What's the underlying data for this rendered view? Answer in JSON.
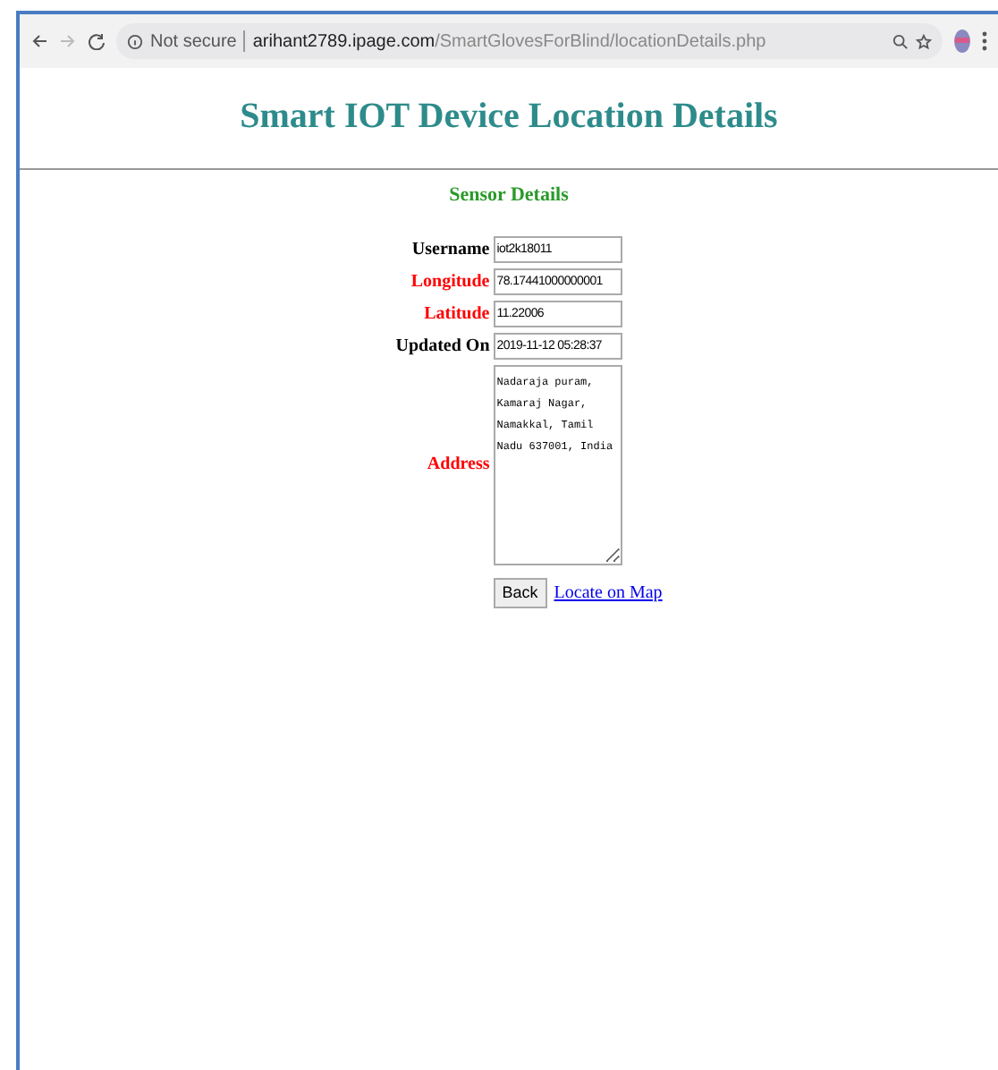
{
  "browser": {
    "security": "Not secure",
    "url_host": "arihant2789.ipage.com",
    "url_path": "/SmartGlovesForBlind/locationDetails.php"
  },
  "page": {
    "title": "Smart IOT Device Location Details",
    "section": "Sensor Details",
    "fields": [
      {
        "label": "Username",
        "color": "#000000",
        "kind": "text",
        "value": "iot2k18011"
      },
      {
        "label": "Longitude",
        "color": "#ff0000",
        "kind": "text",
        "value": "78.17441000000001"
      },
      {
        "label": "Latitude",
        "color": "#ff0000",
        "kind": "text",
        "value": "11.22006"
      },
      {
        "label": "Updated On",
        "color": "#000000",
        "kind": "text",
        "value": "2019-11-12 05:28:37"
      },
      {
        "label": "Address",
        "color": "#ff0000",
        "kind": "textarea",
        "value": "Nadaraja puram, Kamaraj Nagar, Namakkal, Tamil Nadu 637001, India"
      }
    ],
    "back_button": "Back",
    "map_link": "Locate on Map"
  }
}
